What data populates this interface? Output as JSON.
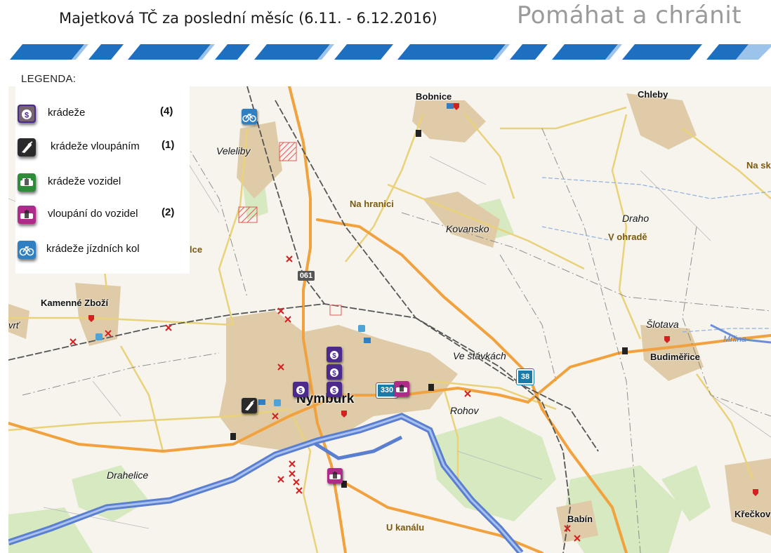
{
  "header": {
    "title": "Majetková TČ za poslední měsíc (6.11. - 6.12.2016)",
    "slogan": "Pomáhat a chránit"
  },
  "legend": {
    "title": "LEGENDA:",
    "items": [
      {
        "label": "krádeže",
        "count": "(4)",
        "icon": "money-bag-icon",
        "color": "#4b2a8c"
      },
      {
        "label": "krádeže vloupáním",
        "count": "(1)",
        "icon": "crowbar-icon",
        "color": "#2a2a2a"
      },
      {
        "label": "krádeže vozidel",
        "count": "",
        "icon": "car-hand-icon",
        "color": "#2e8b3a"
      },
      {
        "label": "vloupání do vozidel",
        "count": "(2)",
        "icon": "car-break-in-icon",
        "color": "#b02a8a"
      },
      {
        "label": "krádeže jízdních kol",
        "count": "",
        "icon": "bicycle-icon",
        "color": "#2f7fc1"
      }
    ]
  },
  "map": {
    "places": {
      "bobnice": "Bobnice",
      "chleby": "Chleby",
      "na_sk": "Na sk",
      "veleliby": "Veleliby",
      "na_hranici": "Na hranici",
      "kovansko": "Kovansko",
      "draho": "Draho",
      "v_ohrade": "V ohradě",
      "lce": "lce",
      "kamenne_zbozi": "Kamenné Zboží",
      "vrt": "vrť",
      "slotava": "Šlotava",
      "mrlina": "Mrlina",
      "budimerice": "Budiměřice",
      "ve_stavkach": "Ve stávkách",
      "nymburk": "Nymburk",
      "rohov": "Rohov",
      "drahelice": "Drahelice",
      "u_kanalu": "U kanálu",
      "babin": "Babín",
      "kreckov": "Křečkov"
    },
    "roads": {
      "r061": "061",
      "r330": "330",
      "r38": "38"
    }
  },
  "colors": {
    "map_bg": "#f4f2ea",
    "town": "#ddc9a6",
    "main_road": "#f2a640",
    "river": "#5b7fd0",
    "forest": "#cfe5b6",
    "banner": "#1f6fc1"
  }
}
